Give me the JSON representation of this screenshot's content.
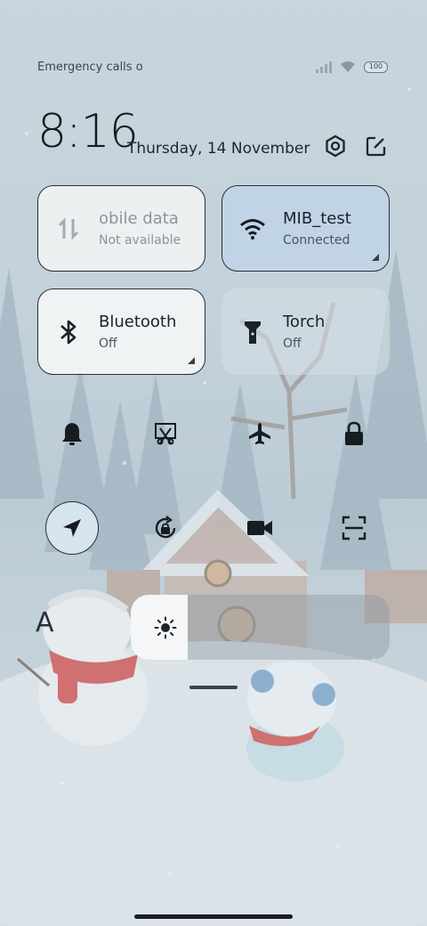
{
  "status_bar": {
    "carrier_text": "Emergency calls o",
    "battery": "100",
    "icons": [
      "signal-icon",
      "wifi-icon",
      "battery-icon"
    ]
  },
  "header": {
    "time": "8:16",
    "date": "Thursday, 14 November",
    "icons": [
      "settings-icon",
      "edit-icon"
    ]
  },
  "tiles": {
    "mobile_data": {
      "title": "obile data",
      "subtitle": "Not available",
      "icon": "mobile-data-icon"
    },
    "wifi": {
      "title": "MIB_test",
      "subtitle": "Connected",
      "icon": "wifi-icon",
      "active": true
    },
    "bluetooth": {
      "title": "Bluetooth",
      "subtitle": "Off",
      "icon": "bluetooth-icon"
    },
    "torch": {
      "title": "Torch",
      "subtitle": "Off",
      "icon": "torch-icon"
    }
  },
  "toggles": [
    {
      "name": "silent",
      "icon": "bell-icon"
    },
    {
      "name": "screenshot",
      "icon": "screenshot-icon"
    },
    {
      "name": "airplane",
      "icon": "airplane-icon"
    },
    {
      "name": "lock",
      "icon": "lock-icon"
    },
    {
      "name": "location",
      "icon": "location-icon",
      "active": true
    },
    {
      "name": "rotation-lock",
      "icon": "rotation-lock-icon"
    },
    {
      "name": "screen-record",
      "icon": "video-camera-icon"
    },
    {
      "name": "scanner",
      "icon": "scan-icon"
    }
  ],
  "brightness": {
    "level": 0.22,
    "icon": "sun-icon",
    "font_size_label": "A"
  },
  "colors": {
    "active_tile": "#c0d4e6",
    "tile_border": "#2a2f35"
  }
}
